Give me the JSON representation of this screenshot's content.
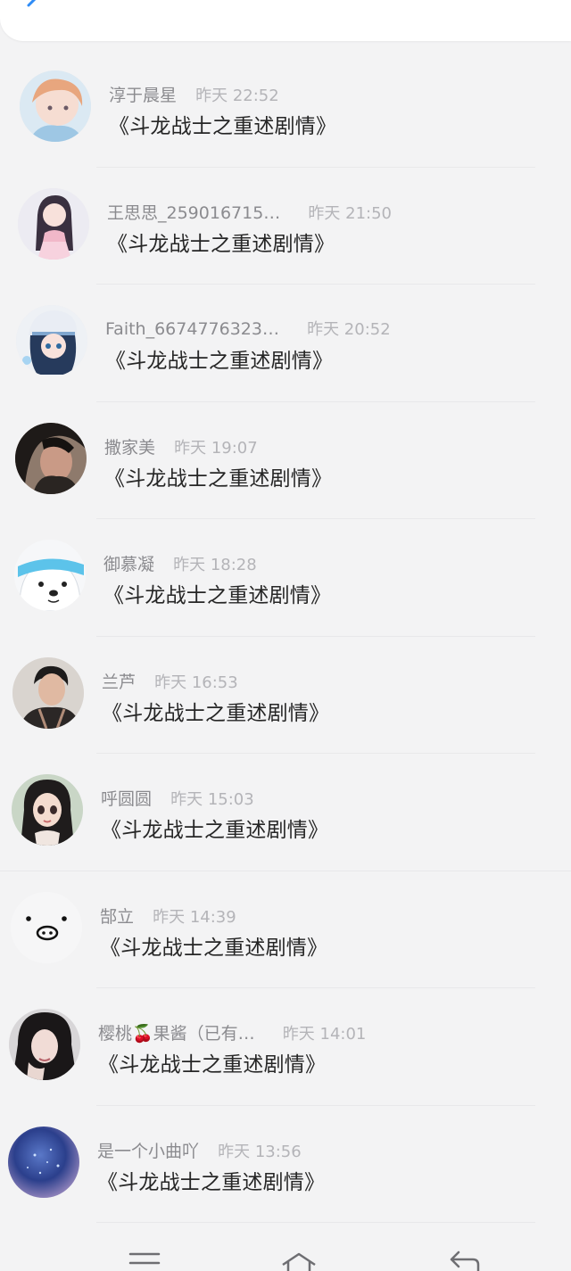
{
  "top_bar": {
    "back_icon": "chevron-left-icon"
  },
  "messages": [
    {
      "name": "淳于晨星",
      "time": "昨天 22:52",
      "text": "《斗龙战士之重述剧情》",
      "avatar": "anime-boy"
    },
    {
      "name": "王思思_259016715…",
      "time": "昨天 21:50",
      "text": "《斗龙战士之重述剧情》",
      "avatar": "anime-girl-pink"
    },
    {
      "name": "Faith_6674776323…",
      "time": "昨天 20:52",
      "text": "《斗龙战士之重述剧情》",
      "avatar": "anime-girl-hat"
    },
    {
      "name": "撒家美",
      "time": "昨天 19:07",
      "text": "《斗龙战士之重述剧情》",
      "avatar": "photo-dark-hair"
    },
    {
      "name": "御慕凝",
      "time": "昨天 18:28",
      "text": "《斗龙战士之重述剧情》",
      "avatar": "cartoon-bear"
    },
    {
      "name": "兰芦",
      "time": "昨天 16:53",
      "text": "《斗龙战士之重述剧情》",
      "avatar": "photo-young-man"
    },
    {
      "name": "呼圆圆",
      "time": "昨天 15:03",
      "text": "《斗龙战士之重述剧情》",
      "avatar": "3d-girl"
    },
    {
      "name": "郜立",
      "time": "昨天 14:39",
      "text": "《斗龙战士之重述剧情》",
      "avatar": "pig-face"
    },
    {
      "name": "樱桃🍒果酱（已有…",
      "time": "昨天 14:01",
      "text": "《斗龙战士之重述剧情》",
      "avatar": "photo-girl"
    },
    {
      "name": "是一个小曲吖",
      "time": "昨天 13:56",
      "text": "《斗龙战士之重述剧情》",
      "avatar": "blue-sphere"
    }
  ],
  "bottom_nav": [
    "menu-icon",
    "home-icon",
    "back-icon"
  ],
  "colors": {
    "accent": "#2f8cf6",
    "name": "#8b8b8f",
    "time": "#b4b4b8",
    "text": "#262626"
  }
}
